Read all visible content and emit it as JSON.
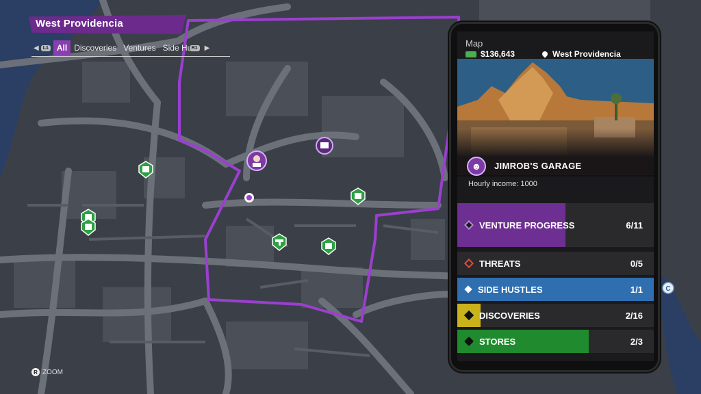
{
  "district": {
    "name": "West Providencia"
  },
  "filters": {
    "left_hint": "L1",
    "right_hint": "R1",
    "tabs": [
      "All",
      "Discoveries",
      "Ventures",
      "Side Hu"
    ],
    "active": "All"
  },
  "zoom": {
    "button": "R",
    "label": "ZOOM"
  },
  "phone": {
    "title": "Map",
    "cash": "$136,643",
    "location": "West Providencia",
    "venture": {
      "name": "JIMROB'S GARAGE",
      "income": "Hourly income: 1000"
    },
    "categories": [
      {
        "label": "Venture Progress",
        "count": "6/11",
        "progress": 0.55,
        "color": "#6d2f91",
        "icon": "diamond-icon"
      },
      {
        "label": "Threats",
        "count": "0/5",
        "progress": 0.0,
        "color": "#c0392b",
        "icon": "diamond-outline-icon"
      },
      {
        "label": "Side Hustles",
        "count": "1/1",
        "progress": 1.0,
        "color": "#2f6fb0",
        "icon": "check-icon"
      },
      {
        "label": "Discoveries",
        "count": "2/16",
        "progress": 0.12,
        "color": "#c9b21a",
        "icon": "diamond-icon"
      },
      {
        "label": "Stores",
        "count": "2/3",
        "progress": 0.67,
        "color": "#1f8a2e",
        "icon": "shield-icon"
      }
    ]
  },
  "colors": {
    "route": "#9b3fd0",
    "road": "#6b7079",
    "water": "#2a3f63",
    "block": "#4b5059"
  }
}
